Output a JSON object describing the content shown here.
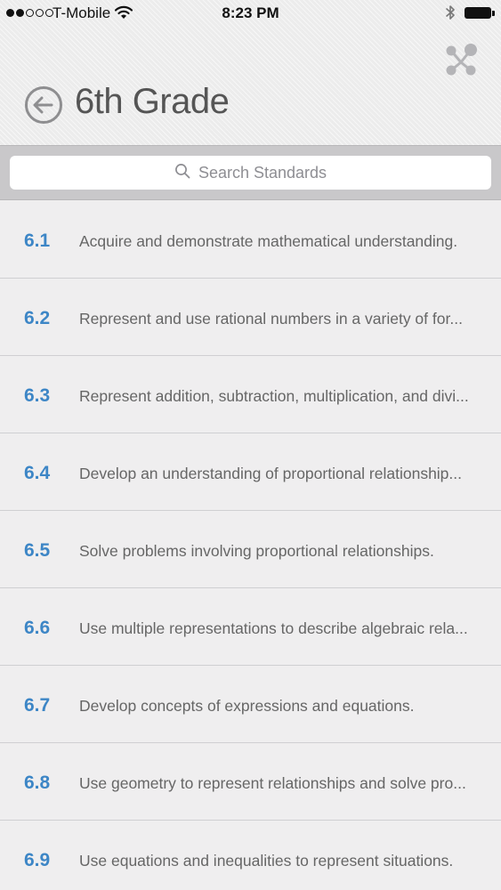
{
  "status_bar": {
    "carrier": "T-Mobile",
    "time": "8:23 PM",
    "signal_bars_filled": 2,
    "signal_bars_total": 5
  },
  "header": {
    "title": "6th Grade",
    "back_icon": "back-arrow-circle-icon",
    "share_icon": "share-icon"
  },
  "search": {
    "placeholder": "Search Standards",
    "icon": "search-icon"
  },
  "colors": {
    "accent": "#3d86c6",
    "text": "#666666",
    "background": "#efeeef",
    "search_band": "#c9c8ca"
  },
  "standards": [
    {
      "number": "6.1",
      "text": "Acquire and demonstrate mathematical understanding."
    },
    {
      "number": "6.2",
      "text": "Represent and use rational numbers in a variety of for..."
    },
    {
      "number": "6.3",
      "text": "Represent addition, subtraction, multiplication, and divi..."
    },
    {
      "number": "6.4",
      "text": "Develop an understanding of proportional relationship..."
    },
    {
      "number": "6.5",
      "text": "Solve problems involving proportional relationships."
    },
    {
      "number": "6.6",
      "text": "Use multiple representations to describe algebraic rela..."
    },
    {
      "number": "6.7",
      "text": "Develop concepts of expressions and equations."
    },
    {
      "number": "6.8",
      "text": "Use geometry to represent relationships and solve pro..."
    },
    {
      "number": "6.9",
      "text": "Use equations and inequalities to represent situations."
    }
  ]
}
